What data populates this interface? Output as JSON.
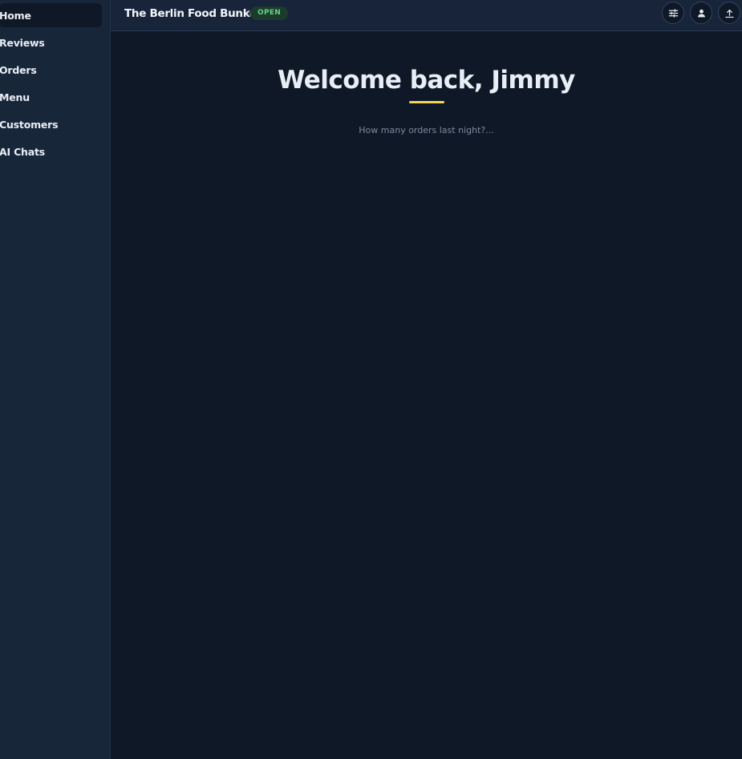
{
  "sidebar": {
    "items": [
      {
        "label": "Home"
      },
      {
        "label": "Reviews"
      },
      {
        "label": "Orders"
      },
      {
        "label": "Menu"
      },
      {
        "label": "Customers"
      },
      {
        "label": "AI Chats"
      }
    ]
  },
  "header": {
    "restaurant_name": "The Berlin Food Bunker",
    "status": "OPEN",
    "actions": [
      {
        "icon": "sliders-icon"
      },
      {
        "icon": "user-icon"
      },
      {
        "icon": "upload-icon"
      }
    ]
  },
  "main": {
    "welcome_title": "Welcome back, Jimmy",
    "prompt_placeholder": "How many orders last night?..."
  },
  "colors": {
    "background": "#0f1826",
    "sidebar": "#18263a",
    "accent_underline": "#f2d35b",
    "status_green": "#62d183"
  }
}
